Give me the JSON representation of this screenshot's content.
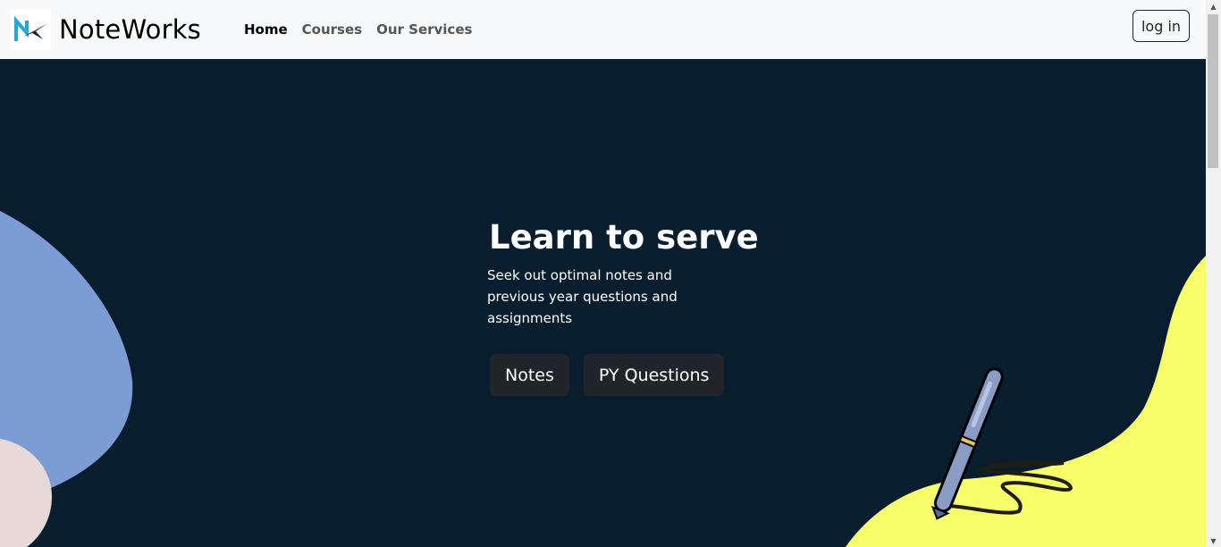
{
  "brand": {
    "name": "NoteWorks",
    "logo_icon": "noteworks-logo-icon"
  },
  "nav": {
    "items": [
      {
        "label": "Home",
        "active": true
      },
      {
        "label": "Courses",
        "active": false
      },
      {
        "label": "Our Services",
        "active": false
      }
    ]
  },
  "auth": {
    "login_label": "log in"
  },
  "hero": {
    "title": "Learn to serve",
    "subtitle": "Seek out optimal notes and previous year questions and assignments",
    "buttons": [
      {
        "label": "Notes"
      },
      {
        "label": "PY Questions"
      }
    ],
    "decor_icon": "pen-icon"
  },
  "colors": {
    "navbar_bg": "#f8f9fa",
    "hero_bg": "#081e2e",
    "blob_blue": "#7b9dd4",
    "blob_pink": "#e8d9d8",
    "blob_yellow": "#f8fd6a",
    "button_dark": "#212529"
  }
}
